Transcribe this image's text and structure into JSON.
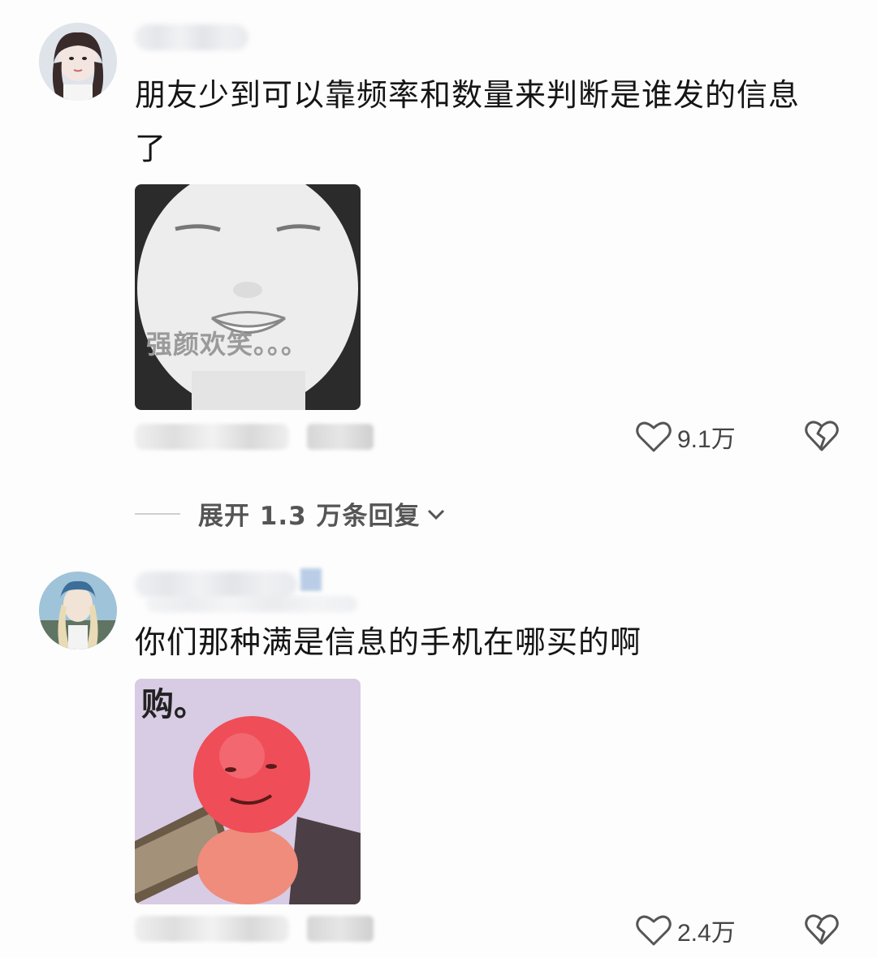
{
  "comments": [
    {
      "text_line1": "朋友少到可以靠频率和数量来判断是谁发的信息",
      "text_line2": "了",
      "sticker_caption": "强颜欢笑。。。",
      "likes": "9.1万"
    },
    {
      "text_line1": "你们那种满是信息的手机在哪买的啊",
      "sticker_caption": "购。",
      "likes": "2.4万"
    }
  ],
  "expand_replies": "展开 1.3 万条回复",
  "icons": {
    "like": "heart-outline-icon",
    "dislike": "broken-heart-icon",
    "expand": "chevron-down-icon"
  },
  "colors": {
    "background": "#fdfdfd",
    "text": "#151515",
    "meta": "#555555",
    "sticker2_face": "#ef4d57"
  }
}
